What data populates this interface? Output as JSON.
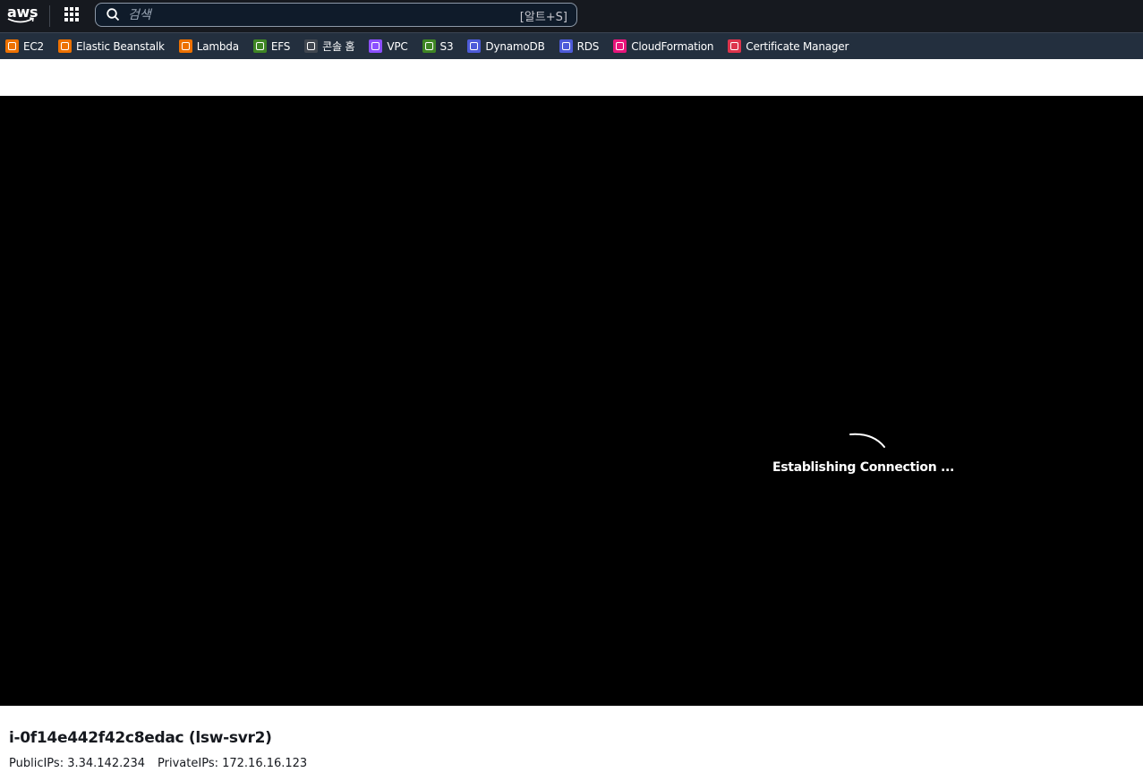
{
  "topnav": {
    "logo_text": "aws",
    "search_placeholder": "검색",
    "search_shortcut": "[알트+S]"
  },
  "favorites": [
    {
      "label": "EC2",
      "icon": "ec2-icon",
      "color": "#ed7100"
    },
    {
      "label": "Elastic Beanstalk",
      "icon": "elastic-beanstalk-icon",
      "color": "#ed7100"
    },
    {
      "label": "Lambda",
      "icon": "lambda-icon",
      "color": "#ed7100"
    },
    {
      "label": "EFS",
      "icon": "efs-icon",
      "color": "#3f8624"
    },
    {
      "label": "콘솔 홈",
      "icon": "console-home-icon",
      "color": "#414750"
    },
    {
      "label": "VPC",
      "icon": "vpc-icon",
      "color": "#8c4fff"
    },
    {
      "label": "S3",
      "icon": "s3-icon",
      "color": "#3f8624"
    },
    {
      "label": "DynamoDB",
      "icon": "dynamodb-icon",
      "color": "#4d5bd9"
    },
    {
      "label": "RDS",
      "icon": "rds-icon",
      "color": "#4d5bd9"
    },
    {
      "label": "CloudFormation",
      "icon": "cloudformation-icon",
      "color": "#e7157b"
    },
    {
      "label": "Certificate Manager",
      "icon": "certificate-manager-icon",
      "color": "#dd344c"
    }
  ],
  "terminal": {
    "status": "Establishing Connection ..."
  },
  "instance": {
    "title": "i-0f14e442f42c8edac (lsw-svr2)",
    "public_ips": "PublicIPs: 3.34.142.234",
    "private_ips": "PrivateIPs: 172.16.16.123"
  }
}
